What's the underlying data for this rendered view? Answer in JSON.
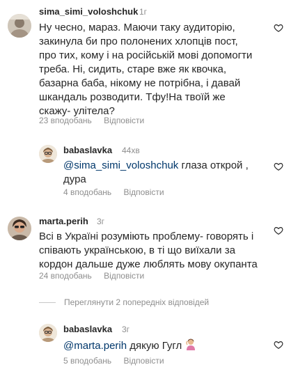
{
  "comments": [
    {
      "username": "sima_simi_voloshchuk",
      "time": "1г",
      "lines": [
        "Ну чесно, мараз. Маючи таку аудиторію,",
        "закинула би про полонених хлопців пост,",
        "про тих, кому і на російській мові допомогти",
        "треба. Ні, сидить, старе вже як квочка,",
        "базарна баба, нікому не потрібна, і давай",
        "шкандаль розводити. Тфу!На твоїй же",
        "скажу- улітела?"
      ],
      "likes": "23 вподобань",
      "reply": "Відповісти"
    },
    {
      "username": "babaslavka",
      "time": "44хв",
      "mention": "@sima_simi_voloshchuk",
      "lines": [
        "глаза открой ,",
        "дура"
      ],
      "likes": "4 вподобань",
      "reply": "Відповісти"
    },
    {
      "username": "marta.perih",
      "time": "3г",
      "lines": [
        "Всі в Україні розуміють проблему- говорять і",
        "співають українською, в ті що виїхали за",
        "кордон дальше дуже люблять мову окупанта"
      ],
      "likes": "24 вподобань",
      "reply": "Відповісти"
    },
    {
      "username": "babaslavka",
      "time": "3г",
      "mention": "@marta.perih",
      "lines": [
        "дякую Гугл"
      ],
      "likes": "5 вподобань",
      "reply": "Відповісти"
    }
  ],
  "view_previous": "Переглянути 2 попередніх відповідей",
  "colors": {
    "text": "#262626",
    "secondary": "#8e8e8e",
    "mention": "#00376b"
  },
  "icons": [
    "heart-icon",
    "person-gesturing-emoji"
  ]
}
